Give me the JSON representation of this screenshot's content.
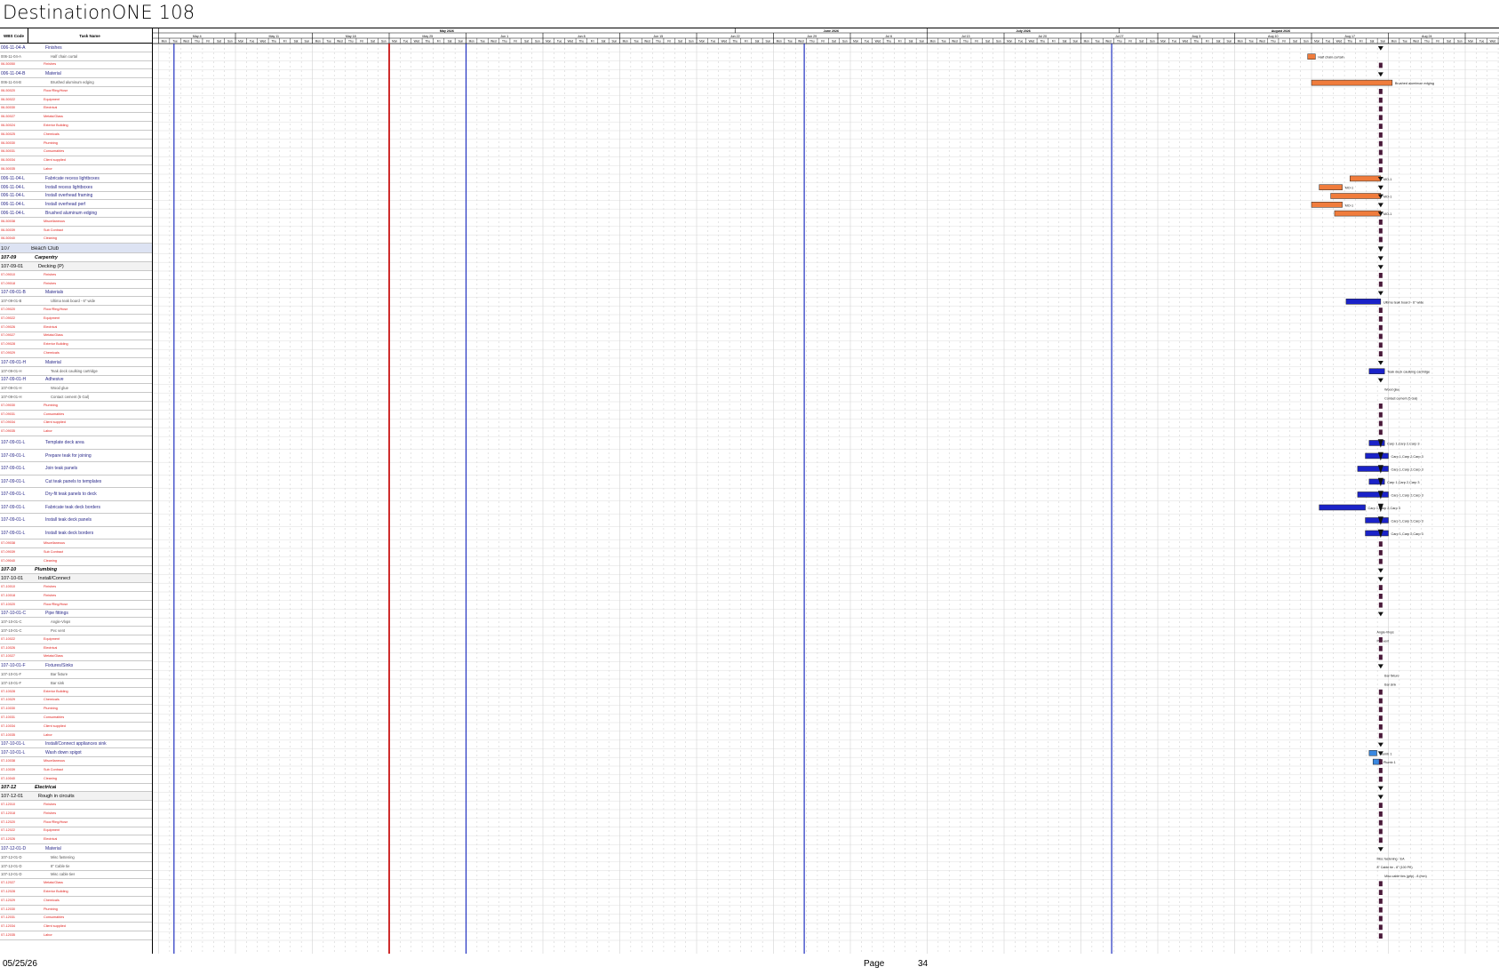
{
  "page_title": "DestinationONE 108",
  "columns": {
    "wbs": "WBS Code",
    "task": "Task Name"
  },
  "timescale": {
    "months": [
      {
        "label": "May 2026",
        "start": 0,
        "end": 15
      },
      {
        "label": "June 2026",
        "start": 15,
        "end": 20
      },
      {
        "label": "July 2026",
        "start": 20,
        "end": 25
      },
      {
        "label": "August 2026",
        "start": 25,
        "end": 33.4
      }
    ],
    "weeks": [
      "May 4",
      "May 11",
      "May 18",
      "May 25",
      "Jun 1",
      "Jun 8",
      "Jun 15",
      "Jun 22",
      "Jun 29",
      "Jul 6",
      "Jul 13",
      "Jul 20",
      "Jul 27",
      "Aug 3",
      "Aug 10",
      "Aug 17",
      "Aug 24",
      "Aug 31"
    ],
    "days": [
      "Mon",
      "Tue",
      "Wed",
      "Thu",
      "Fri",
      "Sat",
      "Sun"
    ]
  },
  "rows": [
    {
      "w": "006-11-04-A",
      "n": "Finishes",
      "s": "blue"
    },
    {
      "w": "006-11-04-A",
      "n": "Half chain curtal",
      "s": "grey"
    },
    {
      "w": "06-50050",
      "n": "Finishes",
      "s": "red"
    },
    {
      "w": "006-11-04-B",
      "n": "Material",
      "s": "blue"
    },
    {
      "w": "006-11-04-B",
      "n": "Brushed aluminum edging",
      "s": "grey"
    },
    {
      "w": "06-50020",
      "n": "Floor/Ring/Hose",
      "s": "red"
    },
    {
      "w": "06-50022",
      "n": "Equipment",
      "s": "red"
    },
    {
      "w": "06-50030",
      "n": "Electrical",
      "s": "red"
    },
    {
      "w": "06-50027",
      "n": "Metals/Glass",
      "s": "red"
    },
    {
      "w": "06-50024",
      "n": "Exterior Building",
      "s": "red"
    },
    {
      "w": "06-50025",
      "n": "Chemicals",
      "s": "red"
    },
    {
      "w": "06-50030",
      "n": "Plumbing",
      "s": "red"
    },
    {
      "w": "06-50031",
      "n": "Consumables",
      "s": "red"
    },
    {
      "w": "06-50034",
      "n": "Client supplied",
      "s": "red"
    },
    {
      "w": "06-50035",
      "n": "Labor",
      "s": "red"
    },
    {
      "w": "006-11-04-L",
      "n": "Fabricate recess lightboxes",
      "s": "blue"
    },
    {
      "w": "006-11-04-L",
      "n": "Install recess lightboxes",
      "s": "blue"
    },
    {
      "w": "006-11-04-L",
      "n": "Install overhead framing",
      "s": "blue"
    },
    {
      "w": "006-11-04-L",
      "n": "Install overhead perf",
      "s": "blue"
    },
    {
      "w": "006-11-04-L",
      "n": "Brushed aluminum edging",
      "s": "blue"
    },
    {
      "w": "06-50038",
      "n": "Miscellaneous",
      "s": "red"
    },
    {
      "w": "06-50039",
      "n": "Sub Contract",
      "s": "red"
    },
    {
      "w": "06-50040",
      "n": "Cleaning",
      "s": "red"
    },
    {
      "w": "107",
      "n": "Beach Club",
      "s": "sum"
    },
    {
      "w": "107-09",
      "n": "Carpentry",
      "s": "bold"
    },
    {
      "w": "107-09-01",
      "n": "Decking (P)",
      "s": "sub"
    },
    {
      "w": "07-09010",
      "n": "Finishes",
      "s": "red"
    },
    {
      "w": "07-09018",
      "n": "Finishes",
      "s": "red"
    },
    {
      "w": "107-09-01-B",
      "n": "Materials",
      "s": "blue"
    },
    {
      "w": "107-09-01-B",
      "n": "Ultima teak board - 6\" wide",
      "s": "grey"
    },
    {
      "w": "07-09020",
      "n": "Floor/Ring/Hose",
      "s": "red"
    },
    {
      "w": "07-09022",
      "n": "Equipment",
      "s": "red"
    },
    {
      "w": "07-09026",
      "n": "Electrical",
      "s": "red"
    },
    {
      "w": "07-09027",
      "n": "Metals/Glass",
      "s": "red"
    },
    {
      "w": "07-09028",
      "n": "Exterior Building",
      "s": "red"
    },
    {
      "w": "07-09029",
      "n": "Chemicals",
      "s": "red"
    },
    {
      "w": "107-09-01-H",
      "n": "Material",
      "s": "blue"
    },
    {
      "w": "107-09-01-H",
      "n": "Teak deck caulking cartridge",
      "s": "grey"
    },
    {
      "w": "107-09-01-H",
      "n": "Adhesive",
      "s": "blue"
    },
    {
      "w": "107-09-01-H",
      "n": "Wood glue",
      "s": "grey"
    },
    {
      "w": "107-09-01-H",
      "n": "Contact cement (5 Gal)",
      "s": "grey"
    },
    {
      "w": "07-09030",
      "n": "Plumbing",
      "s": "red"
    },
    {
      "w": "07-09031",
      "n": "Consumables",
      "s": "red"
    },
    {
      "w": "07-09034",
      "n": "Client supplied",
      "s": "red"
    },
    {
      "w": "07-09035",
      "n": "Labor",
      "s": "red"
    },
    {
      "w": "107-09-01-L",
      "n": "Template deck area",
      "s": "blue",
      "tall": 1
    },
    {
      "w": "107-09-01-L",
      "n": "Prepare teak for joining",
      "s": "blue",
      "tall": 1
    },
    {
      "w": "107-09-01-L",
      "n": "Join teak panels",
      "s": "blue",
      "tall": 1
    },
    {
      "w": "107-09-01-L",
      "n": "Cut teak panels to templates",
      "s": "blue",
      "tall": 1
    },
    {
      "w": "107-09-01-L",
      "n": "Dry-fit teak panels to deck",
      "s": "blue",
      "tall": 1
    },
    {
      "w": "107-09-01-L",
      "n": "Fabricate teak deck borders",
      "s": "blue",
      "tall": 1
    },
    {
      "w": "107-09-01-L",
      "n": "Install teak deck panels",
      "s": "blue",
      "tall": 1
    },
    {
      "w": "107-09-01-L",
      "n": "Install teak deck borders",
      "s": "blue",
      "tall": 1
    },
    {
      "w": "07-09038",
      "n": "Miscellaneous",
      "s": "red"
    },
    {
      "w": "07-09039",
      "n": "Sub Contract",
      "s": "red"
    },
    {
      "w": "07-09040",
      "n": "Cleaning",
      "s": "red"
    },
    {
      "w": "107-10",
      "n": "Plumbing",
      "s": "bold"
    },
    {
      "w": "107-10-01",
      "n": "Install/Connect",
      "s": "sub"
    },
    {
      "w": "07-10010",
      "n": "Finishes",
      "s": "red"
    },
    {
      "w": "07-10018",
      "n": "Finishes",
      "s": "red"
    },
    {
      "w": "07-10020",
      "n": "Floor/Ring/Hose",
      "s": "red"
    },
    {
      "w": "107-10-01-C",
      "n": "Pipe fittings",
      "s": "blue"
    },
    {
      "w": "107-10-01-C",
      "n": "Angle-Vlvps",
      "s": "grey"
    },
    {
      "w": "107-10-01-C",
      "n": "Pvc vent",
      "s": "grey"
    },
    {
      "w": "07-10022",
      "n": "Equipment",
      "s": "red"
    },
    {
      "w": "07-10026",
      "n": "Electrical",
      "s": "red"
    },
    {
      "w": "07-10027",
      "n": "Metals/Glass",
      "s": "red"
    },
    {
      "w": "107-10-01-F",
      "n": "Fixtures/Sinks",
      "s": "blue"
    },
    {
      "w": "107-10-01-F",
      "n": "Bar fixture",
      "s": "grey"
    },
    {
      "w": "107-10-01-F",
      "n": "Bar sink",
      "s": "grey"
    },
    {
      "w": "07-10028",
      "n": "Exterior Building",
      "s": "red"
    },
    {
      "w": "07-10029",
      "n": "Chemicals",
      "s": "red"
    },
    {
      "w": "07-10030",
      "n": "Plumbing",
      "s": "red"
    },
    {
      "w": "07-10031",
      "n": "Consumables",
      "s": "red"
    },
    {
      "w": "07-10034",
      "n": "Client supplied",
      "s": "red"
    },
    {
      "w": "07-10035",
      "n": "Labor",
      "s": "red"
    },
    {
      "w": "107-10-01-L",
      "n": "Install/Connect appliances sink",
      "s": "blue"
    },
    {
      "w": "107-10-01-L",
      "n": "Wash down spigot",
      "s": "blue"
    },
    {
      "w": "07-10038",
      "n": "Miscellaneous",
      "s": "red"
    },
    {
      "w": "07-10039",
      "n": "Sub Contract",
      "s": "red"
    },
    {
      "w": "07-10040",
      "n": "Cleaning",
      "s": "red"
    },
    {
      "w": "107-12",
      "n": "Electrical",
      "s": "bold"
    },
    {
      "w": "107-12-01",
      "n": "Rough in circuits",
      "s": "sub"
    },
    {
      "w": "07-12010",
      "n": "Finishes",
      "s": "red"
    },
    {
      "w": "07-12018",
      "n": "Finishes",
      "s": "red"
    },
    {
      "w": "07-12020",
      "n": "Floor/Ring/Hose",
      "s": "red"
    },
    {
      "w": "07-12022",
      "n": "Equipment",
      "s": "red"
    },
    {
      "w": "07-12026",
      "n": "Electrical",
      "s": "red"
    },
    {
      "w": "107-12-01-D",
      "n": "Material",
      "s": "blue"
    },
    {
      "w": "107-12-01-D",
      "n": "Misc fastening",
      "s": "grey"
    },
    {
      "w": "107-12-01-D",
      "n": "8\" Cable tie",
      "s": "grey"
    },
    {
      "w": "107-12-01-D",
      "n": "Misc cable ties",
      "s": "grey"
    },
    {
      "w": "07-12027",
      "n": "Metals/Glass",
      "s": "red"
    },
    {
      "w": "07-12028",
      "n": "Exterior Building",
      "s": "red"
    },
    {
      "w": "07-12029",
      "n": "Chemicals",
      "s": "red"
    },
    {
      "w": "07-12030",
      "n": "Plumbing",
      "s": "red"
    },
    {
      "w": "07-12031",
      "n": "Consumables",
      "s": "red"
    },
    {
      "w": "07-12034",
      "n": "Client supplied",
      "s": "red"
    },
    {
      "w": "07-12035",
      "n": "Labor",
      "s": "red"
    }
  ],
  "gantt": {
    "bars": [
      {
        "row": 1,
        "start": 32.1,
        "end": 32.2,
        "kind": "orange",
        "label": "Half chain curtain"
      },
      {
        "row": 4,
        "start": 32.15,
        "end": 33.2,
        "kind": "orange",
        "label": "Brushed aluminum edging"
      },
      {
        "row": 15,
        "start": 32.65,
        "end": 33.05,
        "kind": "orange",
        "label": "MO-1"
      },
      {
        "row": 16,
        "start": 32.25,
        "end": 32.55,
        "kind": "orange",
        "label": "MO-1"
      },
      {
        "row": 17,
        "start": 32.4,
        "end": 33.05,
        "kind": "orange",
        "label": "MO-1"
      },
      {
        "row": 18,
        "start": 32.15,
        "end": 32.55,
        "kind": "orange",
        "label": "MO-1"
      },
      {
        "row": 19,
        "start": 32.45,
        "end": 33.05,
        "kind": "orange",
        "label": "MO-1"
      },
      {
        "row": 29,
        "start": 32.6,
        "end": 33.05,
        "kind": "blue",
        "label": "Ultima teak board - 6\" wide"
      },
      {
        "row": 37,
        "start": 32.9,
        "end": 33.1,
        "kind": "blue",
        "label": "Teak deck caulking cartridge"
      },
      {
        "row": 45,
        "start": 32.9,
        "end": 33.1,
        "kind": "blue",
        "label": "Carp 1,Carp 2,Carp 3"
      },
      {
        "row": 46,
        "start": 32.85,
        "end": 33.15,
        "kind": "blue",
        "label": "Carp 1,Carp 2,Carp 3"
      },
      {
        "row": 47,
        "start": 32.75,
        "end": 33.15,
        "kind": "blue",
        "label": "Carp 1,Carp 2,Carp 3"
      },
      {
        "row": 48,
        "start": 32.9,
        "end": 33.1,
        "kind": "blue",
        "label": "Carp 1,Carp 2,Carp 3"
      },
      {
        "row": 49,
        "start": 32.75,
        "end": 33.15,
        "kind": "blue",
        "label": "Carp 1,Carp 2,Carp 3"
      },
      {
        "row": 50,
        "start": 32.25,
        "end": 32.85,
        "kind": "blue",
        "label": "Carp 1,Carp 2,Carp 3"
      },
      {
        "row": 51,
        "start": 32.85,
        "end": 33.15,
        "kind": "blue",
        "label": "Carp 1,Carp 2,Carp 3"
      },
      {
        "row": 52,
        "start": 32.85,
        "end": 33.15,
        "kind": "blue",
        "label": "Carp 1,Carp 2,Carp 3"
      },
      {
        "row": 77,
        "start": 32.9,
        "end": 33.0,
        "kind": "lightblue",
        "label": "Plumb 1"
      },
      {
        "row": 78,
        "start": 32.95,
        "end": 33.05,
        "kind": "lightblue",
        "label": "Plumb 1"
      }
    ],
    "labels": [
      {
        "row": 39,
        "x": 33.1,
        "text": "Wood glue"
      },
      {
        "row": 40,
        "x": 33.1,
        "text": "Contact cement (5 Gal)"
      },
      {
        "row": 63,
        "x": 33.0,
        "text": "Angle-Vlvps"
      },
      {
        "row": 64,
        "x": 33.0,
        "text": "Pvc vent"
      },
      {
        "row": 68,
        "x": 33.1,
        "text": "Bar fixture"
      },
      {
        "row": 69,
        "x": 33.1,
        "text": "Bar sink"
      },
      {
        "row": 89,
        "x": 33.0,
        "text": "Misc fastening - EA"
      },
      {
        "row": 90,
        "x": 33.0,
        "text": "8\" Cable tie - 8\" (100 PK)"
      },
      {
        "row": 91,
        "x": 33.1,
        "text": "Misc cable ties (grip) - 8 (mm)"
      }
    ],
    "milestone_col": 33.05,
    "palette": {
      "orange": "#f07c3c",
      "blue": "#1a22c8",
      "lightblue": "#3a88e0",
      "today": "#c81414",
      "week_line": "#2030c0",
      "milestone": "#4a1a3a"
    }
  },
  "footer": {
    "date": "05/25/26",
    "page_label": "Page",
    "page_number": "34"
  }
}
